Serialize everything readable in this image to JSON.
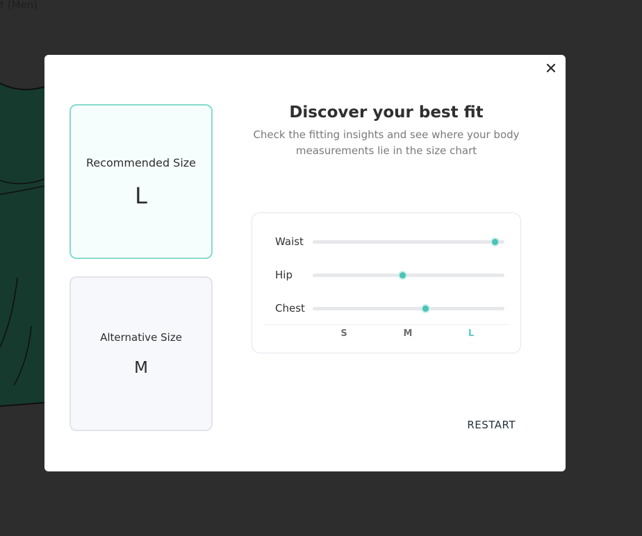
{
  "background": {
    "partial_title": "t (Men)"
  },
  "modal": {
    "close_icon": "close-icon"
  },
  "recommended": {
    "label": "Recommended Size",
    "size": "L"
  },
  "alternative": {
    "label": "Alternative Size",
    "size": "M"
  },
  "header": {
    "title": "Discover your best fit",
    "subtitle": "Check the fitting insights and see where your body measurements lie in the size chart"
  },
  "fit": {
    "rows": [
      {
        "label": "Waist",
        "level": 0.95
      },
      {
        "label": "Hip",
        "level": 0.47
      },
      {
        "label": "Chest",
        "level": 0.59
      }
    ],
    "scale": [
      {
        "label": "S",
        "active": false
      },
      {
        "label": "M",
        "active": false
      },
      {
        "label": "L",
        "active": true
      }
    ]
  },
  "actions": {
    "restart_label": "RESTART"
  },
  "colors": {
    "accent": "#4ec2b6",
    "accent_border": "#86dccc",
    "overlay": "#2d2d2d"
  }
}
